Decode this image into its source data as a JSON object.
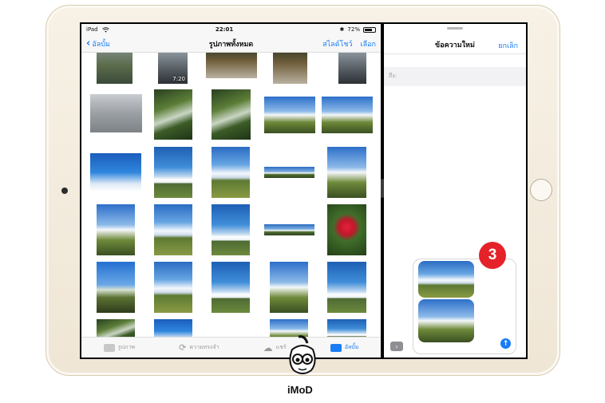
{
  "status_bar": {
    "device": "iPad",
    "time": "22:01",
    "battery": "72%",
    "battery_level": 0.72
  },
  "photos": {
    "back_label": "อัลบั้ม",
    "title": "รูปภาพทั้งหมด",
    "slideshow_label": "สไลด์โชว์",
    "select_label": "เลือก",
    "video_duration": "7:20",
    "tabs": [
      {
        "label": "รูปภาพ",
        "icon": "photos-icon",
        "active": false
      },
      {
        "label": "ความทรงจำ",
        "icon": "memories-icon",
        "active": false
      },
      {
        "label": "แชร์",
        "icon": "shared-cloud-icon",
        "active": false
      },
      {
        "label": "อัลบั้ม",
        "icon": "albums-folder-icon",
        "active": true
      }
    ]
  },
  "messages": {
    "title": "ข้อความใหม่",
    "cancel_label": "ยกเลิก",
    "to_label": "ถึง:",
    "apps_button": "›",
    "send_icon": "↑"
  },
  "callout_number": "3",
  "watermark": {
    "text": "iMoD"
  },
  "colors": {
    "accent": "#1a7cf5",
    "callout": "#e52229"
  }
}
